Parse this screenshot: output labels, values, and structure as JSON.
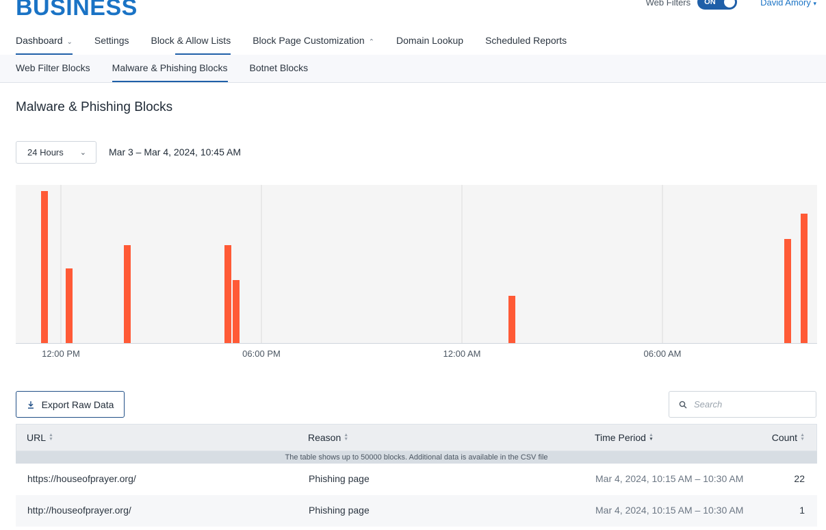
{
  "brand": "BUSINESS",
  "header": {
    "web_filters_label": "Web Filters",
    "toggle_label": "ON",
    "user_name": "David Amory"
  },
  "main_nav": [
    {
      "label": "Dashboard",
      "active": true,
      "caret": "chevron-down"
    },
    {
      "label": "Settings"
    },
    {
      "label": "Block & Allow Lists"
    },
    {
      "label": "Block Page Customization",
      "caret": "chevron-up"
    },
    {
      "label": "Domain Lookup"
    },
    {
      "label": "Scheduled Reports"
    }
  ],
  "sub_nav": [
    {
      "label": "Web Filter Blocks"
    },
    {
      "label": "Malware & Phishing Blocks",
      "active": true
    },
    {
      "label": "Botnet Blocks"
    }
  ],
  "page_title": "Malware & Phishing Blocks",
  "range": {
    "selected": "24 Hours",
    "date_range": "Mar 3 – Mar 4, 2024, 10:45 AM"
  },
  "chart_data": {
    "type": "bar",
    "x_tick_labels": [
      "12:00 PM",
      "06:00 PM",
      "12:00 AM",
      "06:00 AM"
    ],
    "y_axis_labels_shown": false,
    "bars_relative_height": [
      0.96,
      0.47,
      0.62,
      0.62,
      0.4,
      0.3,
      0.66,
      0.82
    ],
    "color": "#ff5a36",
    "grid": true
  },
  "toolbar": {
    "export_label": "Export Raw Data",
    "search_placeholder": "Search"
  },
  "table": {
    "columns": [
      "URL",
      "Reason",
      "Time Period",
      "Count"
    ],
    "notice": "The table shows up to 50000 blocks. Additional data is available in the CSV file",
    "rows": [
      {
        "url": "https://houseofprayer.org/",
        "reason": "Phishing page",
        "period": "Mar 4, 2024, 10:15 AM – 10:30 AM",
        "count": "22"
      },
      {
        "url": "http://houseofprayer.org/",
        "reason": "Phishing page",
        "period": "Mar 4, 2024, 10:15 AM – 10:30 AM",
        "count": "1"
      }
    ]
  }
}
